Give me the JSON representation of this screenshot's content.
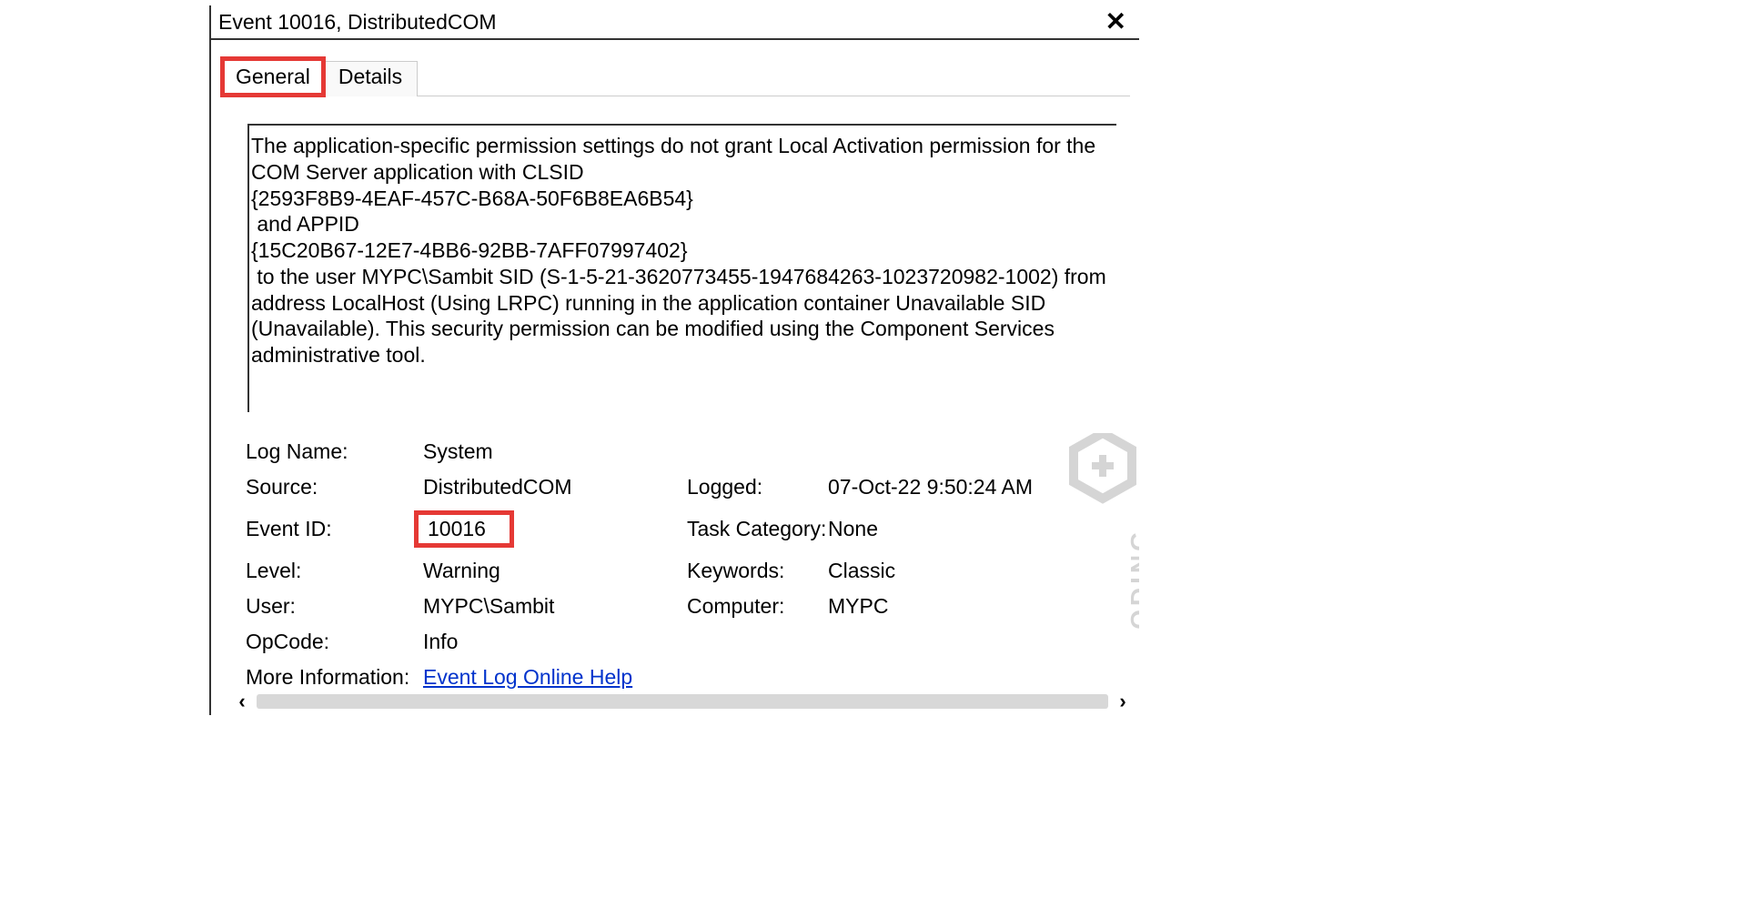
{
  "window": {
    "title": "Event 10016, DistributedCOM"
  },
  "tabs": {
    "general": "General",
    "details": "Details"
  },
  "description": "The application-specific permission settings do not grant Local Activation permission for the COM Server application with CLSID\n{2593F8B9-4EAF-457C-B68A-50F6B8EA6B54}\n and APPID\n{15C20B67-12E7-4BB6-92BB-7AFF07997402}\n to the user MYPC\\Sambit SID (S-1-5-21-3620773455-1947684263-1023720982-1002) from address LocalHost (Using LRPC) running in the application container Unavailable SID (Unavailable). This security permission can be modified using the Component Services administrative tool.",
  "meta": {
    "log_name_label": "Log Name:",
    "log_name": "System",
    "source_label": "Source:",
    "source": "DistributedCOM",
    "logged_label": "Logged:",
    "logged": "07-Oct-22 9:50:24 AM",
    "event_id_label": "Event ID:",
    "event_id": "10016",
    "task_category_label": "Task Category:",
    "task_category": "None",
    "level_label": "Level:",
    "level": "Warning",
    "keywords_label": "Keywords:",
    "keywords": "Classic",
    "user_label": "User:",
    "user": "MYPC\\Sambit",
    "computer_label": "Computer:",
    "computer": "MYPC",
    "opcode_label": "OpCode:",
    "opcode": "Info",
    "more_info_label": "More Information:",
    "more_info_link": "Event Log Online Help"
  },
  "watermark": "ODING"
}
